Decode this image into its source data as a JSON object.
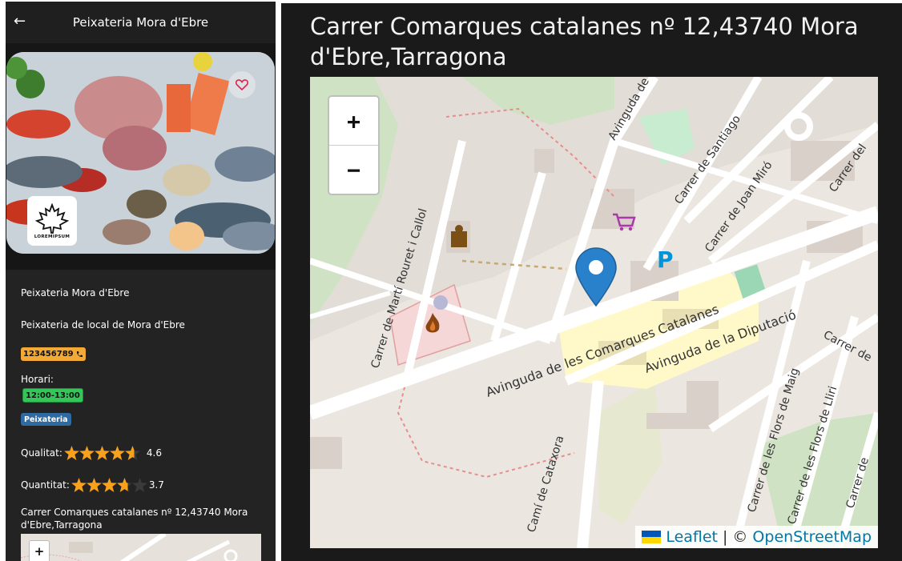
{
  "app": {
    "title": "Peixateria Mora d'Ebre",
    "back_icon": "arrow-left-icon"
  },
  "hero": {
    "favorite_icon": "heart-outline-icon",
    "logo_text": "LOREMIPSUM"
  },
  "details": {
    "name": "Peixateria Mora d'Ebre",
    "description": "Peixateria de local de Mora d'Ebre",
    "phone": "123456789",
    "phone_icon": "phone-icon",
    "hours_label": "Horari:",
    "hours": "12:00-13:00",
    "category": "Peixateria",
    "ratings": [
      {
        "label": "Qualitat:",
        "value": "4.6",
        "score": 4.6
      },
      {
        "label": "Quantitat:",
        "value": "3.7",
        "score": 3.7
      }
    ],
    "address": "Carrer Comarques catalanes nº 12,43740 Mora d'Ebre,Tarragona",
    "mini_zoom_label": "+"
  },
  "map_panel": {
    "address_title": "Carrer Comarques catalanes nº 12,43740 Mora d'Ebre,Tarragona",
    "zoom_in": "+",
    "zoom_out": "−",
    "attribution": {
      "leaflet": "Leaflet",
      "separator": "|",
      "copyright": "©",
      "osm": "OpenStreetMap"
    },
    "street_labels": {
      "avinguda_comarques": "Avinguda de les Comarques Catalanes",
      "avinguda_diputacio": "Avinguda de la Diputació",
      "marti_rouret": "Carrer de Martí Rouret i Callol",
      "cami_cataxora": "Camí de Cataxora",
      "flors_maig": "Carrer de les Flors de Maig",
      "flors_lliri": "Carrer de les Flors de Lliri",
      "joan_miro": "Carrer de Joan Miró",
      "santiago": "Carrer de Santiago",
      "avinguda_la": "Avinguda de la",
      "carrer_del": "Carrer del",
      "carrer_de": "Carrer de",
      "carrer_de_2": "Carrer de"
    },
    "parking_label": "P",
    "colors": {
      "marker": "#2a81cb",
      "parking": "#0092da",
      "shop": "#ac39ac",
      "accent_badge": "#f3a936",
      "hours_badge": "#35c65a",
      "category_badge": "#2f6aa1",
      "star": "#f7a11c"
    }
  }
}
